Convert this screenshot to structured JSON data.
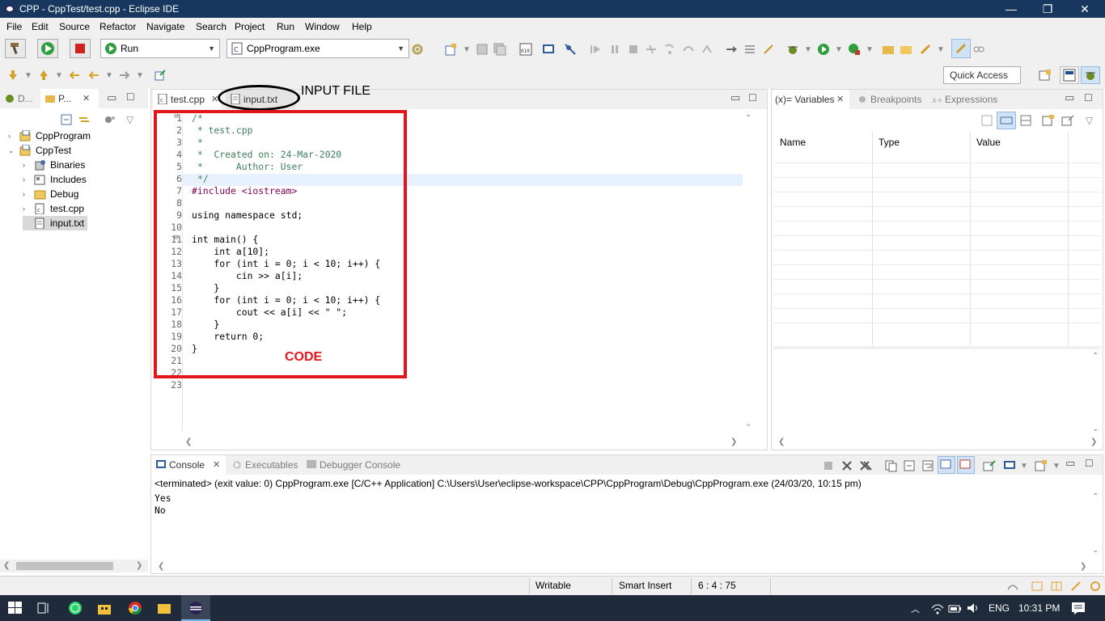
{
  "window": {
    "title": "CPP - CppTest/test.cpp - Eclipse IDE",
    "minimize": "—",
    "restore": "❐",
    "close": "✕"
  },
  "menu": [
    "File",
    "Edit",
    "Source",
    "Refactor",
    "Navigate",
    "Search",
    "Project",
    "Run",
    "Window",
    "Help"
  ],
  "toolbar": {
    "launch_mode": "Run",
    "launch_config": "CppProgram.exe",
    "quick_access_placeholder": "Quick Access"
  },
  "left_panel": {
    "tabs": [
      {
        "label": "D..."
      },
      {
        "label": "P..."
      }
    ],
    "tree": [
      {
        "label": "CppProgram",
        "expander": "›"
      },
      {
        "label": "CppTest",
        "expander": "⌄"
      },
      {
        "label": "Binaries",
        "expander": "›"
      },
      {
        "label": "Includes",
        "expander": "›"
      },
      {
        "label": "Debug",
        "expander": "›"
      },
      {
        "label": "test.cpp",
        "expander": "›"
      },
      {
        "label": "input.txt",
        "expander": ""
      }
    ]
  },
  "editor": {
    "tabs": [
      {
        "label": "test.cpp",
        "close": "✕"
      },
      {
        "label": "input.txt"
      }
    ],
    "lines": [
      "/*",
      " * test.cpp",
      " *",
      " *  Created on: 24-Mar-2020",
      " *      Author: User",
      " */",
      "#include <iostream>",
      "",
      "using namespace std;",
      "",
      "int main() {",
      "    int a[10];",
      "    for (int i = 0; i < 10; i++) {",
      "        cin >> a[i];",
      "    }",
      "    for (int i = 0; i < 10; i++) {",
      "        cout << a[i] << \" \";",
      "    }",
      "    return 0;",
      "}",
      "",
      "",
      ""
    ]
  },
  "variables_panel": {
    "tabs": [
      {
        "label": "(x)= Variables",
        "close": "✕"
      },
      {
        "label": "Breakpoints"
      },
      {
        "label": "Expressions"
      }
    ],
    "columns": [
      "Name",
      "Type",
      "Value"
    ]
  },
  "console": {
    "tabs": [
      {
        "label": "Console",
        "close": "✕"
      },
      {
        "label": "Executables"
      },
      {
        "label": "Debugger Console"
      }
    ],
    "header": "<terminated> (exit value: 0) CppProgram.exe [C/C++ Application] C:\\Users\\User\\eclipse-workspace\\CPP\\CppProgram\\Debug\\CppProgram.exe (24/03/20, 10:15 pm)",
    "output": [
      "Yes",
      "No"
    ]
  },
  "status_bar": {
    "mode": "Writable",
    "insert": "Smart Insert",
    "position": "6 : 4 : 75"
  },
  "annotations": {
    "input_file": "INPUT FILE",
    "code": "CODE",
    "color": "#e3161c"
  },
  "taskbar": {
    "lang": "ENG",
    "time": "10:31 PM"
  }
}
